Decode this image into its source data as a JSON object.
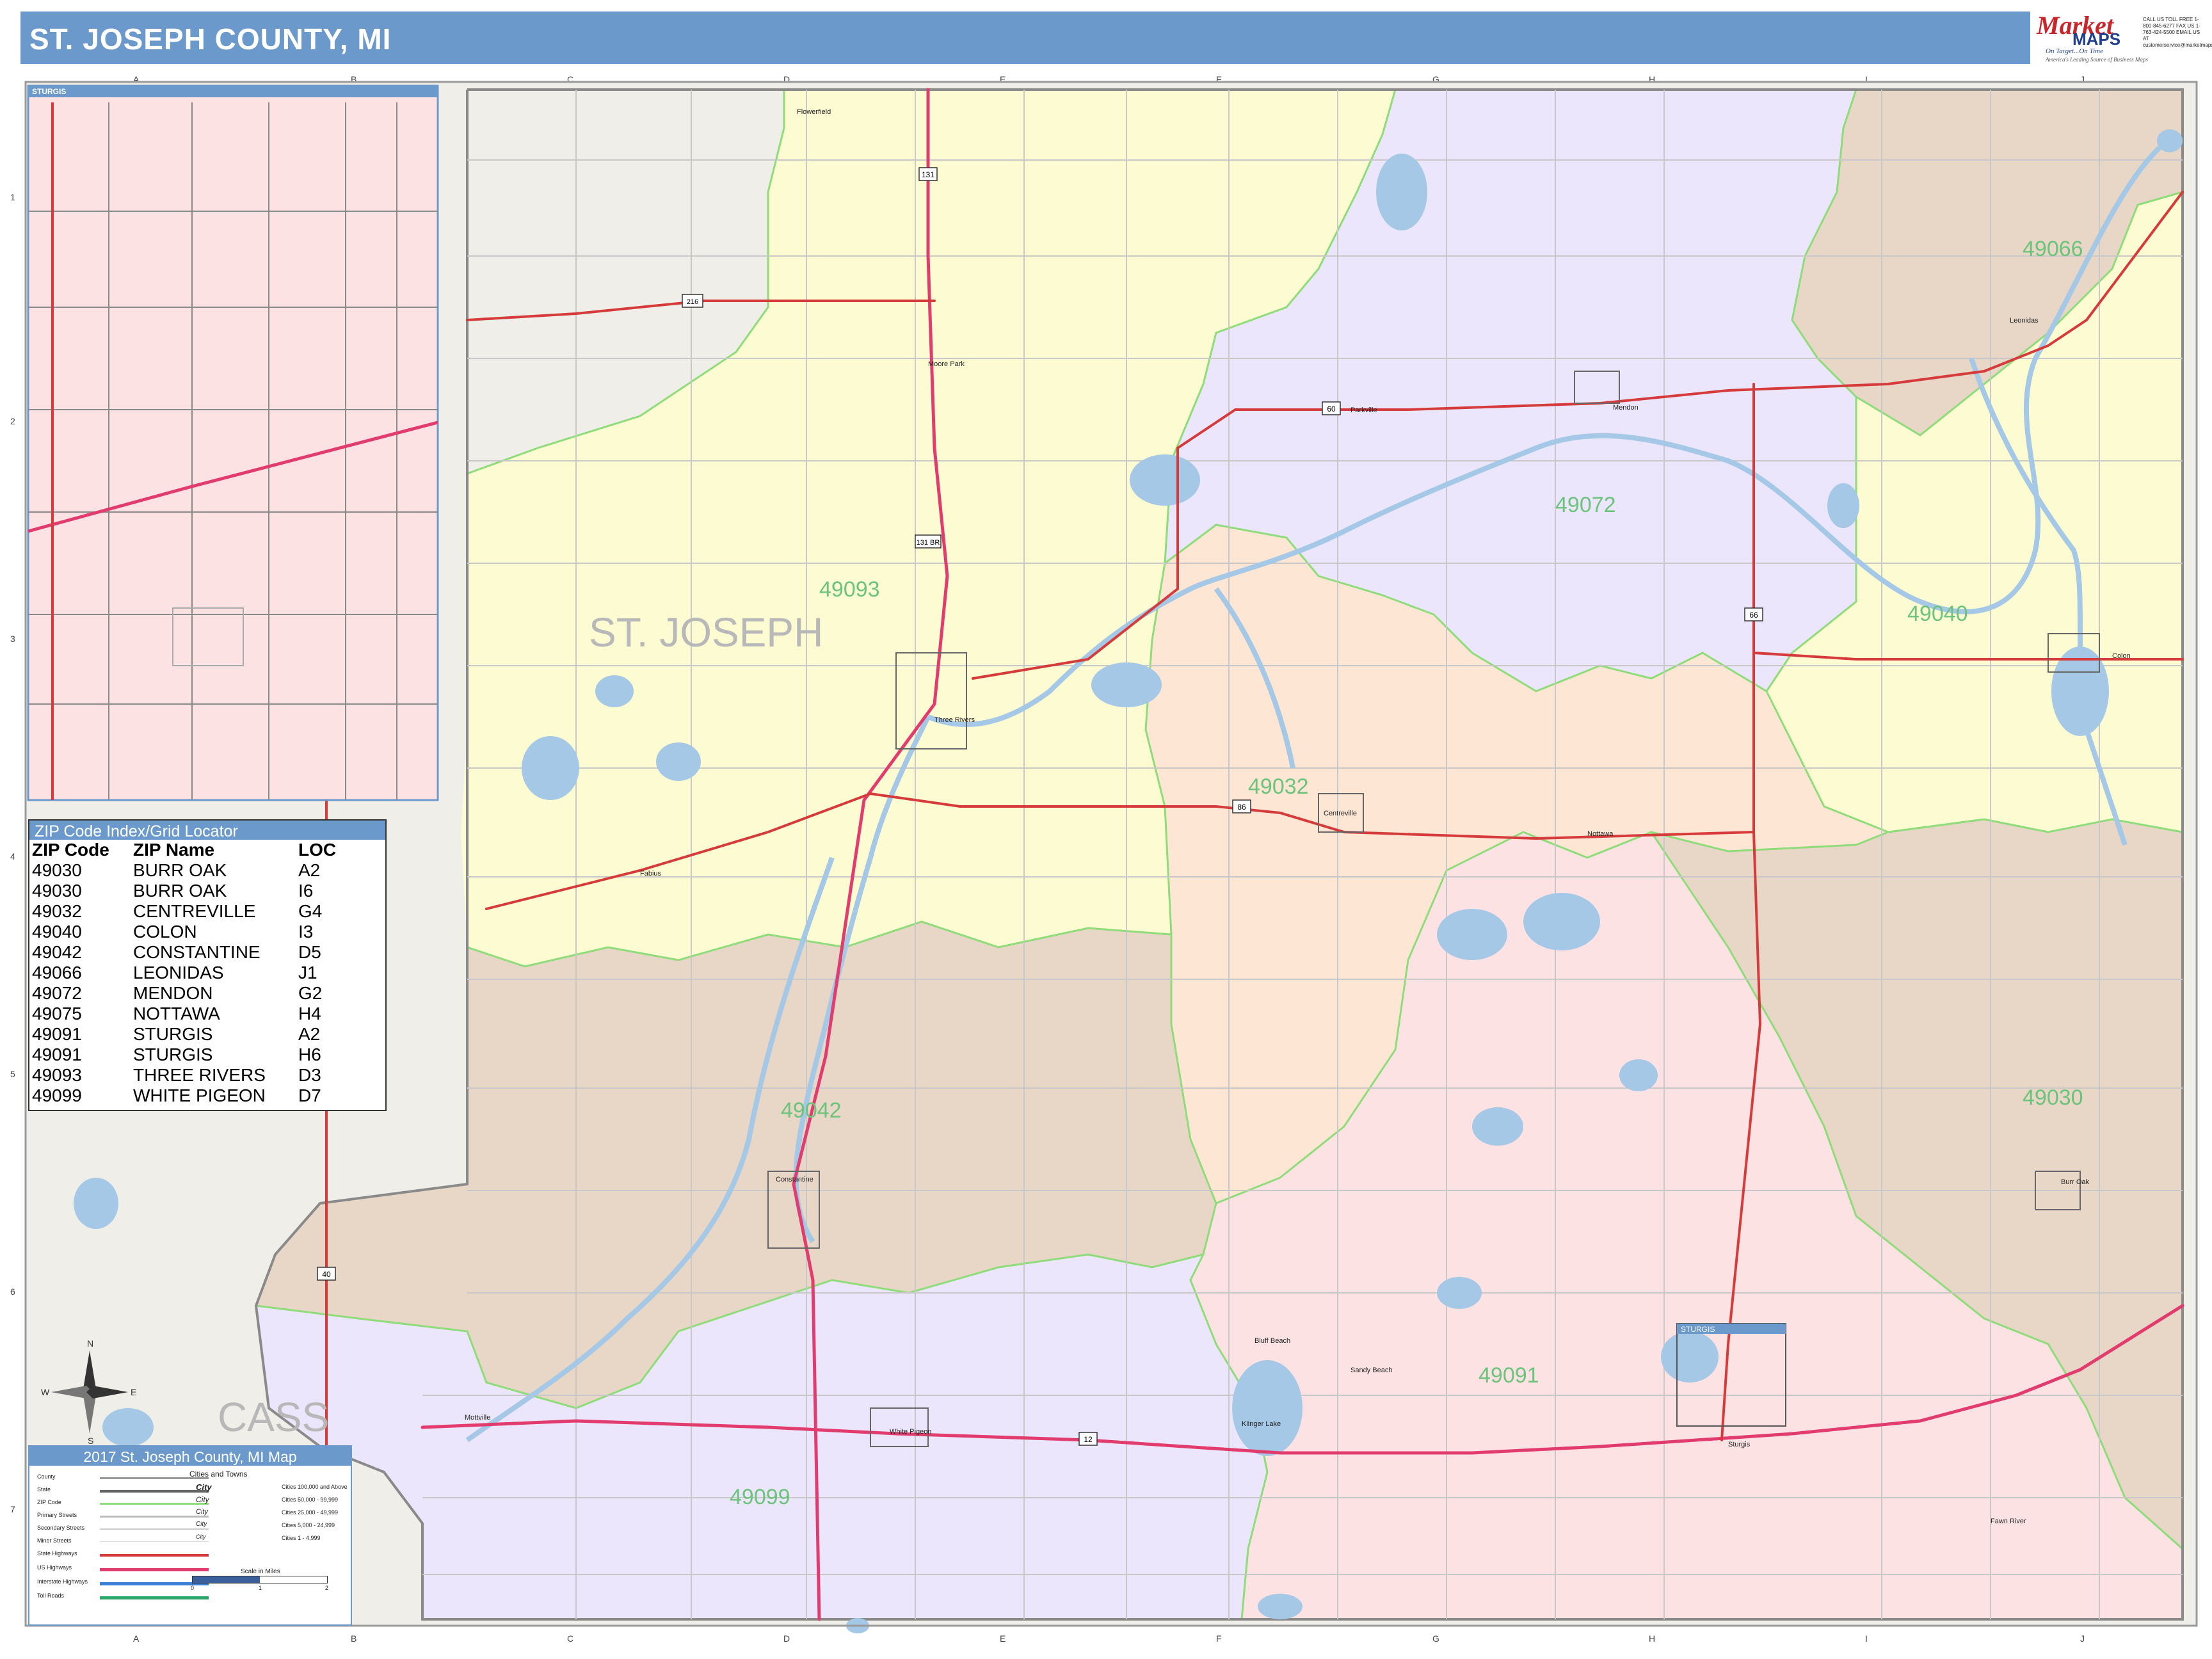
{
  "title": "ST. JOSEPH COUNTY, MI",
  "logo": {
    "brand_top": "Market",
    "brand_bottom": "MAPS",
    "tagline": "On Target...On Time",
    "subtagline": "America's Leading Source of Business Maps",
    "contact": "CALL US TOLL FREE 1-800-845-6277 FAX US 1-763-424-5500 EMAIL US AT customerservice@marketmaps.com"
  },
  "grid": {
    "columns": [
      "A",
      "B",
      "C",
      "D",
      "E",
      "F",
      "G",
      "H",
      "I",
      "J"
    ],
    "rows": [
      "1",
      "2",
      "3",
      "4",
      "5",
      "6",
      "7"
    ]
  },
  "county_labels": [
    {
      "text": "ST. JOSEPH"
    },
    {
      "text": "CASS"
    }
  ],
  "zip_labels": [
    "49093",
    "49066",
    "49072",
    "49040",
    "49032",
    "49042",
    "49030",
    "49091",
    "49099"
  ],
  "highway_shields": [
    "131",
    "131 BR",
    "66",
    "86",
    "60",
    "12",
    "216",
    "40"
  ],
  "places": [
    "Flowerfield",
    "Moore Park",
    "Three Rivers",
    "Fabius",
    "Centreville",
    "Mendon",
    "Parkville",
    "Leonidas",
    "Colon",
    "Nottawa",
    "Constantine",
    "White Pigeon",
    "Mottville",
    "Sturgis",
    "Burr Oak",
    "Klinger Lake",
    "Sandy Beach",
    "Bluff Beach",
    "Fawn River"
  ],
  "inset": {
    "title": "STURGIS",
    "mini_label": "STURGIS"
  },
  "zip_index": {
    "title": "ZIP Code Index/Grid Locator",
    "headers": [
      "ZIP Code",
      "ZIP Name",
      "LOC"
    ],
    "rows": [
      [
        "49030",
        "BURR OAK",
        "A2"
      ],
      [
        "49030",
        "BURR OAK",
        "I6"
      ],
      [
        "49032",
        "CENTREVILLE",
        "G4"
      ],
      [
        "49040",
        "COLON",
        "I3"
      ],
      [
        "49042",
        "CONSTANTINE",
        "D5"
      ],
      [
        "49066",
        "LEONIDAS",
        "J1"
      ],
      [
        "49072",
        "MENDON",
        "G2"
      ],
      [
        "49075",
        "NOTTAWA",
        "H4"
      ],
      [
        "49091",
        "STURGIS",
        "A2"
      ],
      [
        "49091",
        "STURGIS",
        "H6"
      ],
      [
        "49093",
        "THREE RIVERS",
        "D3"
      ],
      [
        "49099",
        "WHITE PIGEON",
        "D7"
      ]
    ]
  },
  "legend": {
    "title": "2017 St. Joseph County, MI Map",
    "items": [
      "County",
      "State",
      "ZIP Code",
      "Primary Streets",
      "Secondary Streets",
      "Minor Streets",
      "State Highways",
      "US Highways",
      "Interstate Highways",
      "Toll Roads"
    ],
    "cities_title": "Cities and Towns",
    "city_sizes": [
      [
        "City",
        "Cities 100,000 and Above"
      ],
      [
        "City",
        "Cities 50,000 - 99,999"
      ],
      [
        "City",
        "Cities 25,000 - 49,999"
      ],
      [
        "City",
        "Cities 5,000 - 24,999"
      ],
      [
        "City",
        "Cities 1 - 4,999"
      ]
    ],
    "scale_label": "Scale in Miles",
    "scale_ticks": [
      "0",
      "1",
      "2"
    ]
  },
  "compass": {
    "n": "N",
    "s": "S",
    "e": "E",
    "w": "W"
  },
  "colors": {
    "title_bar": "#6b99cc",
    "z49093": "#fdfbd2",
    "z49066": "#e8d6c6",
    "z49072": "#ebe6fb",
    "z49040": "#fdfbd2",
    "z49032": "#fde6d3",
    "z49042": "#e8d6c6",
    "z49030": "#e8d6c6",
    "z49091": "#fde2e4",
    "z49099": "#ebe6fb",
    "outside": "#efeee8",
    "water": "#a4c8e6",
    "us_highway": "#e23c6e",
    "state_highway": "#d63b3b",
    "zip_border": "#8fdc7a",
    "zip_text": "#6cc47c"
  }
}
